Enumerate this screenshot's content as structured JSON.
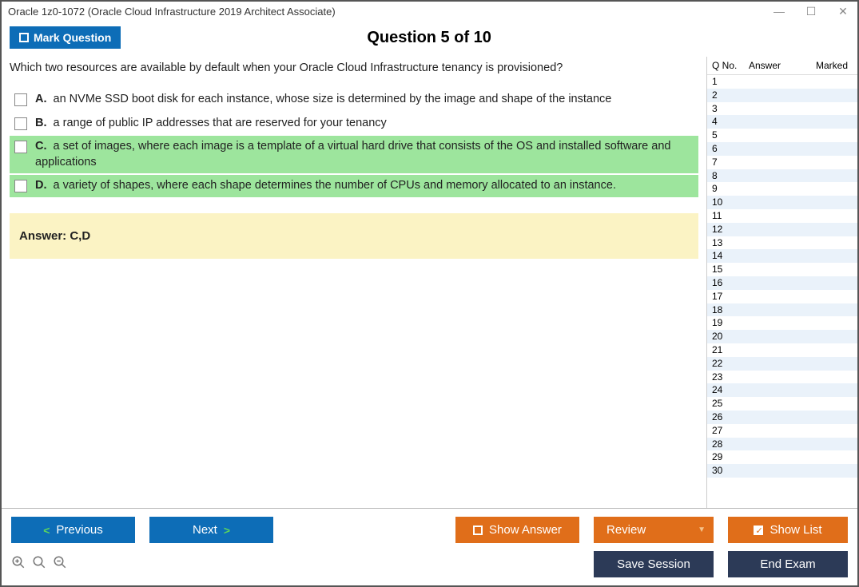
{
  "window": {
    "title": "Oracle 1z0-1072 (Oracle Cloud Infrastructure 2019 Architect Associate)"
  },
  "header": {
    "mark_label": "Mark Question",
    "question_title": "Question 5 of 10"
  },
  "question": {
    "text": "Which two resources are available by default when your Oracle Cloud Infrastructure tenancy is provisioned?",
    "choices": [
      {
        "letter": "A.",
        "text": "an NVMe SSD boot disk for each instance, whose size is determined by the image and shape of the instance",
        "correct": false
      },
      {
        "letter": "B.",
        "text": "a range of public IP addresses that are reserved for your tenancy",
        "correct": false
      },
      {
        "letter": "C.",
        "text": "a set of images, where each image is a template of a virtual hard drive that consists of the OS and installed software and applications",
        "correct": true
      },
      {
        "letter": "D.",
        "text": "a variety of shapes, where each shape determines the number of CPUs and memory allocated to an instance.",
        "correct": true
      }
    ],
    "answer_label": "Answer: C,D"
  },
  "sidebar": {
    "col1": "Q No.",
    "col2": "Answer",
    "col3": "Marked",
    "rows": [
      1,
      2,
      3,
      4,
      5,
      6,
      7,
      8,
      9,
      10,
      11,
      12,
      13,
      14,
      15,
      16,
      17,
      18,
      19,
      20,
      21,
      22,
      23,
      24,
      25,
      26,
      27,
      28,
      29,
      30
    ]
  },
  "buttons": {
    "previous": "Previous",
    "next": "Next",
    "show_answer": "Show Answer",
    "review": "Review",
    "show_list": "Show List",
    "save_session": "Save Session",
    "end_exam": "End Exam"
  }
}
